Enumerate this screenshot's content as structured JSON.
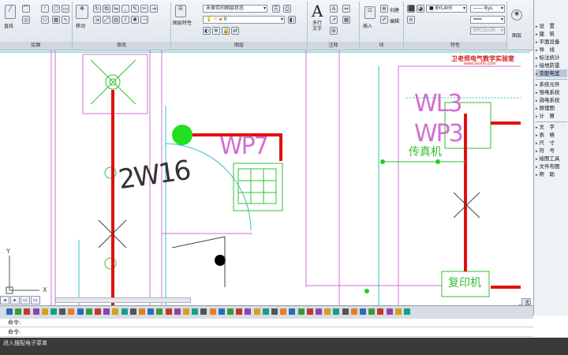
{
  "ribbon": {
    "panels": [
      {
        "title": "绘图",
        "labels": [
          "直线"
        ]
      },
      {
        "title": "修改",
        "labels": [
          "移动"
        ]
      },
      {
        "title": "图层",
        "labels": [
          "图层特性"
        ],
        "layer_state": "未保存的图层状态",
        "current_layer": "0"
      },
      {
        "title": "注释",
        "labels": [
          "多行文字"
        ]
      },
      {
        "title": "块",
        "labels": [
          "插入",
          "创建",
          "编辑"
        ]
      },
      {
        "title": "特性",
        "color": "BYLAYE",
        "linetype": "ByL",
        "plotstyle": "BYCOLOR"
      }
    ],
    "extra_label": "图层"
  },
  "watermark": {
    "text": "卫老师电气教学实验室",
    "url": "www.laoshi.com"
  },
  "drawing": {
    "labels": [
      "WP7",
      "2W16",
      "WL3",
      "WP3",
      "传真机",
      "复印机"
    ],
    "ucs_x": "X",
    "ucs_y": "Y"
  },
  "sidebar": {
    "items": [
      "设　置",
      "建　筑",
      "平面设备",
      "导　线",
      "标注统计",
      "接地防雷",
      "变配电室",
      "系统元件",
      "强电系统",
      "弱电系统",
      "原理图",
      "计　算",
      "文　字",
      "表　格",
      "尺　寸",
      "符　号",
      "绘图工具",
      "文件布图",
      "帮　助"
    ]
  },
  "vertical_tab": "天正电气",
  "command": {
    "line1": "命令:",
    "line2": "命令:"
  },
  "status": {
    "text": "进入搜配电子菜单"
  }
}
